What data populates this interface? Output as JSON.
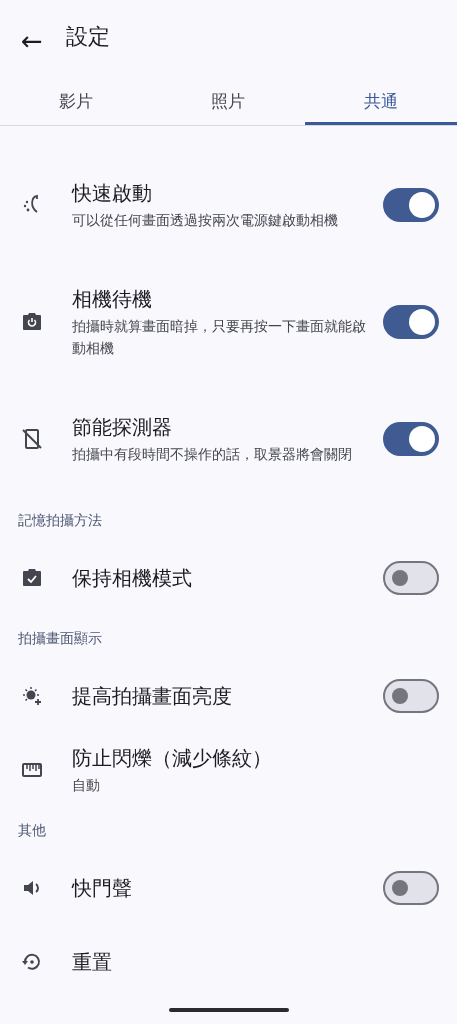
{
  "app_bar": {
    "back": "←",
    "title": "設定"
  },
  "tabs": [
    {
      "label": "影片",
      "selected": false
    },
    {
      "label": "照片",
      "selected": false
    },
    {
      "label": "共通",
      "selected": true
    }
  ],
  "settings": [
    {
      "kind": "item",
      "title": "快速啟動",
      "subtitle": "可以從任何畫面透過按兩次電源鍵啟動相機",
      "on": true
    },
    {
      "kind": "item",
      "title": "相機待機",
      "subtitle": "拍攝時就算畫面暗掉，只要再按一下畫面就能啟動相機",
      "on": true
    },
    {
      "kind": "item",
      "title": "節能探測器",
      "subtitle": "拍攝中有段時間不操作的話，取景器將會關閉",
      "on": true
    },
    {
      "kind": "header",
      "title": "記憶拍攝方法"
    },
    {
      "kind": "item",
      "title": "保持相機模式",
      "on": false
    },
    {
      "kind": "header",
      "title": "拍攝畫面顯示"
    },
    {
      "kind": "item",
      "title": "提高拍攝畫面亮度",
      "on": false
    },
    {
      "kind": "item",
      "title": "防止閃爍（減少條紋）",
      "subtitle": "自動"
    },
    {
      "kind": "header",
      "title": "其他"
    },
    {
      "kind": "item",
      "title": "快門聲",
      "on": false
    },
    {
      "kind": "item",
      "title": "重置"
    }
  ]
}
